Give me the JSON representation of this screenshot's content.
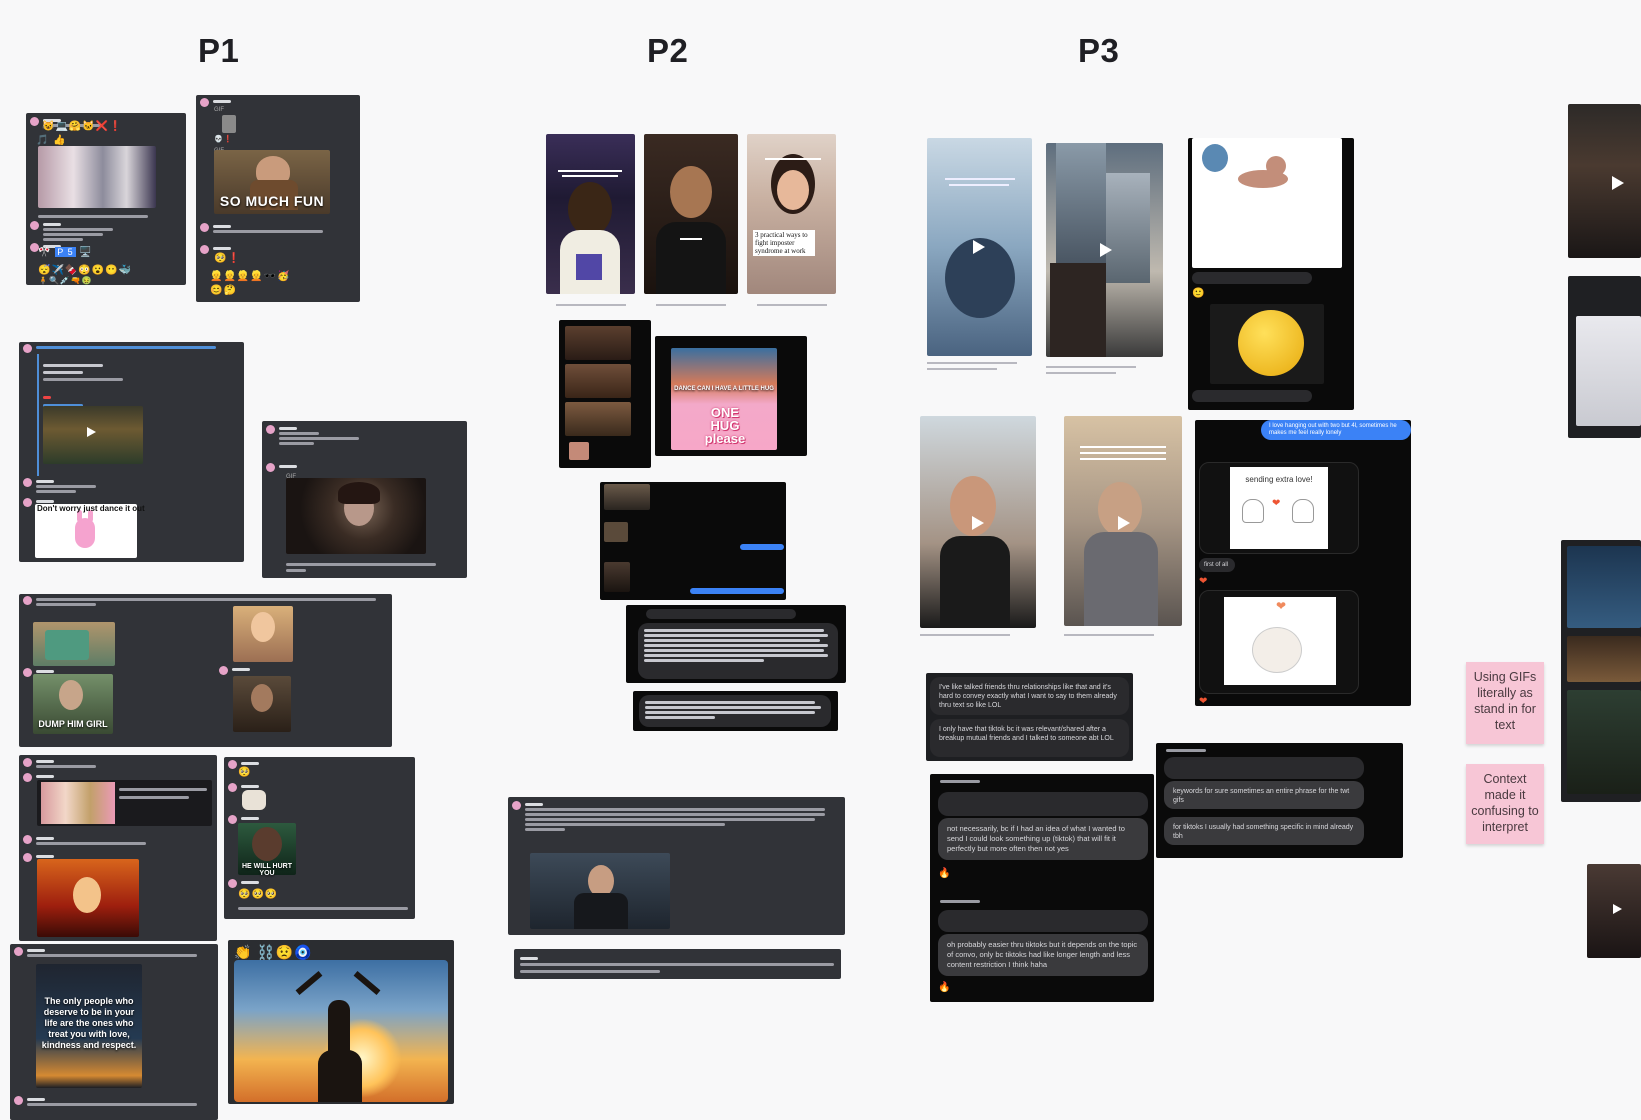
{
  "sections": {
    "p1": "P1",
    "p2": "P2",
    "p3": "P3"
  },
  "p1": {
    "so_much_fun": "SO MUCH FUN",
    "dance_caption": "Don't worry just dance it out",
    "dump_him": "DUMP HIM GIRL",
    "will_hurt": "HE WILL HURT YOU",
    "only_people_quote": "The only people who deserve to be in your life are the ones who treat you with love, kindness and respect."
  },
  "p2": {
    "video1_overlay": "",
    "video2_overlay": "",
    "video3_text": "3 practical ways to fight imposter syndrome at work",
    "one_hug": "ONE HUG please",
    "dance_hug": "DANCE CAN I HAVE A LITTLE HUG"
  },
  "p3": {
    "chat_blue": "I love hanging out with two but 4l, sometimes he makes me feel really lonely",
    "sending_love": "sending extra love!",
    "first_of_all": "first of all",
    "replies_1": [
      "I've like talked friends thru relationships like that and it's hard to convey exactly what I want to say to them already thru text so like LOL",
      "I only have that tiktok bc it was relevant/shared after a breakup mutual friends and I talked to someone abt LOL"
    ],
    "replies_2": [
      "not necessarily, bc if I had an idea of what I wanted to send I could look something up (tiktok) that will fit it perfectly but more often then not yes",
      "oh probably easier thru tiktoks but it depends on the topic of convo, only bc tiktoks had like longer length and less content restriction I think haha"
    ],
    "replies_3": [
      "keywords for sure sometimes an entire phrase for the twt gifs",
      "for tiktoks I usually had something specific in mind already tbh"
    ]
  },
  "stickies": [
    "Using GIFs literally as stand in for text",
    "Context made it confusing to interpret"
  ],
  "colors": {
    "background": "#f8f8f9",
    "discord_card": "#313338",
    "sticky_pink": "#f7c6d6",
    "message_blue": "#3b82f6"
  }
}
